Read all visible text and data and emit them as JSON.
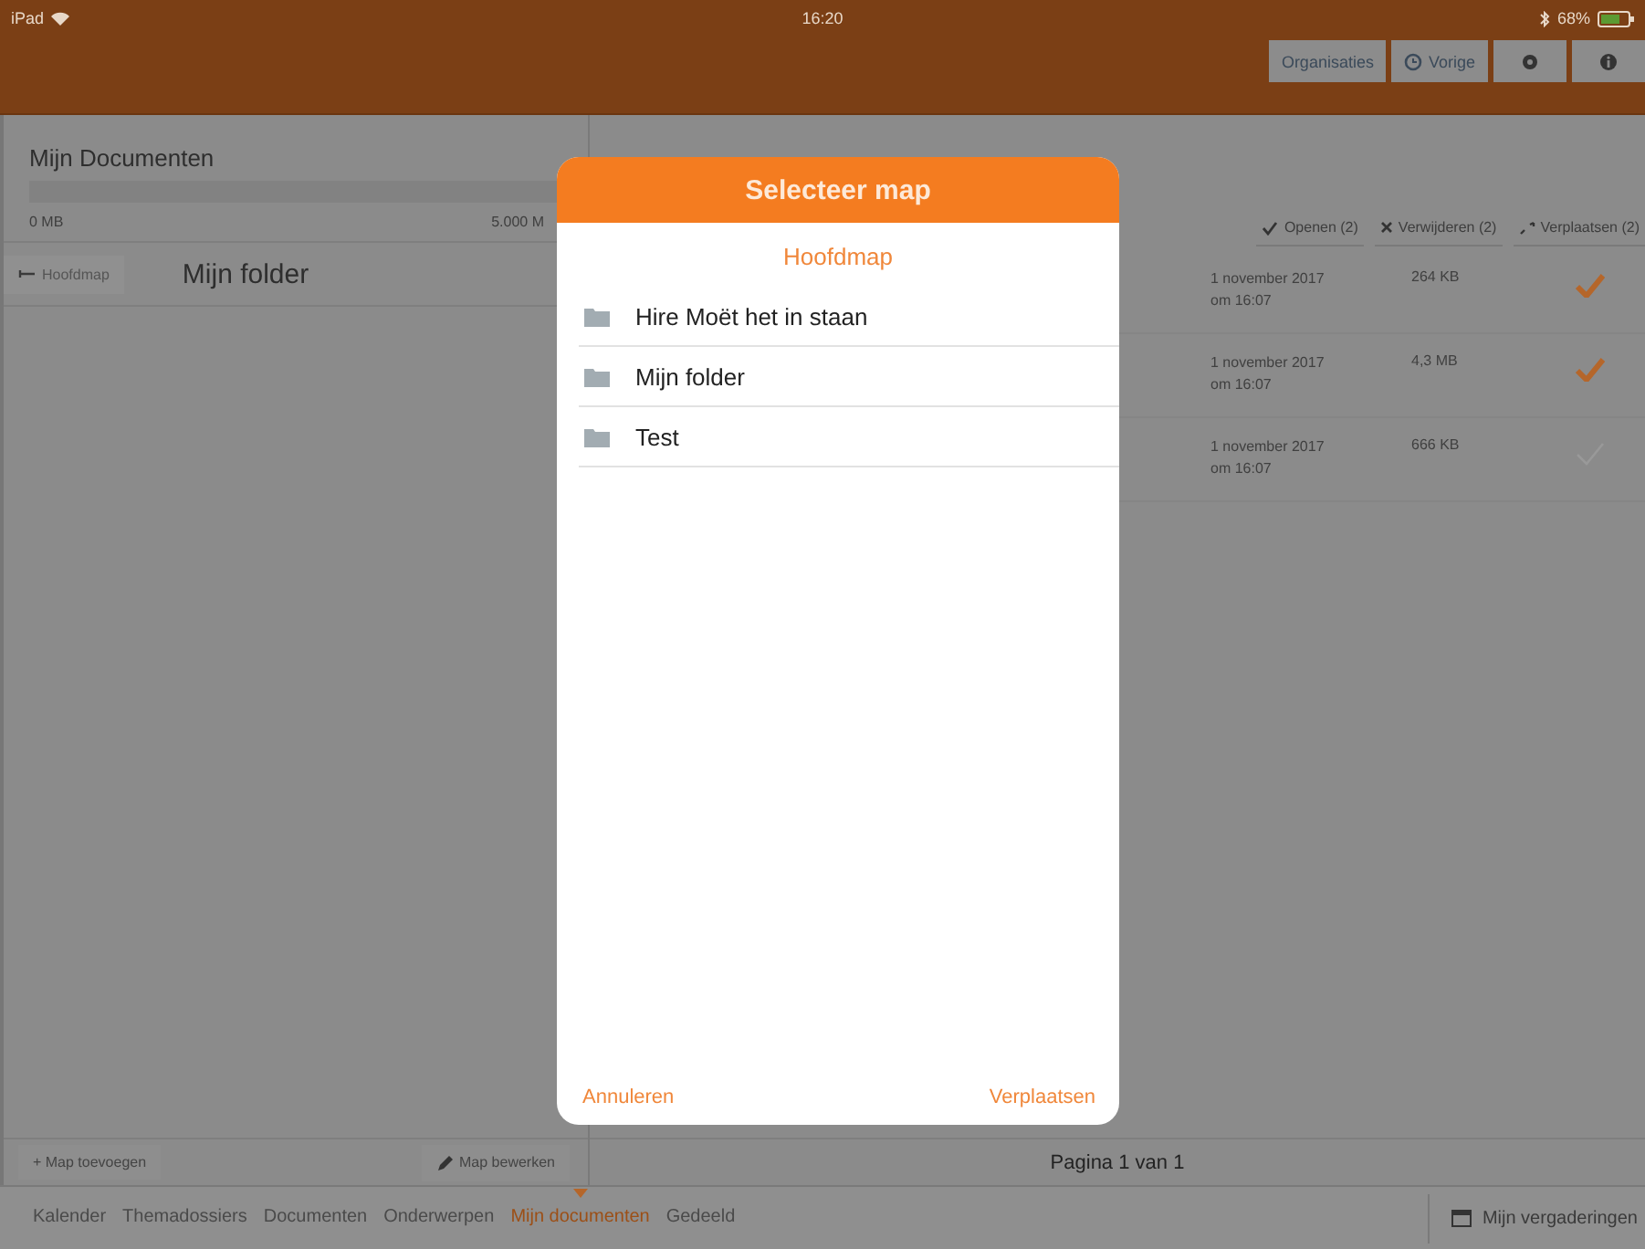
{
  "status_bar": {
    "device": "iPad",
    "time": "16:20",
    "battery": "68%"
  },
  "header": {
    "buttons": [
      {
        "label": "Organisaties",
        "kind": "text"
      },
      {
        "label": "Vorige",
        "kind": "back"
      },
      {
        "kind": "gear"
      },
      {
        "kind": "info"
      }
    ]
  },
  "sidebar": {
    "title": "Mijn Documenten",
    "storage": {
      "min": "0 MB",
      "max": "5.000 M"
    },
    "back_button": "Hoofdmap",
    "folder_title": "Mijn folder",
    "add_button": "Map toevoegen",
    "add_icon": "+",
    "edit_button": "Map bewerken"
  },
  "toolbar": [
    {
      "label": "Openen (2)",
      "kind": "check"
    },
    {
      "label": "Verwijderen (2)",
      "kind": "cross"
    },
    {
      "label": "Verplaatsen (2)",
      "kind": "move"
    }
  ],
  "files": [
    {
      "date": "1 november 2017",
      "time": "om 16:07",
      "size": "264 KB",
      "checked": true
    },
    {
      "date": "1 november 2017",
      "time": "om 16:07",
      "size": "4,3 MB",
      "checked": true
    },
    {
      "date": "1 november 2017",
      "time": "om 16:07",
      "size": "666 KB",
      "checked": false
    }
  ],
  "pagination": "Pagina 1 van 1",
  "tabs": [
    {
      "label": "Kalender",
      "selected": false
    },
    {
      "label": "Themadossiers",
      "selected": false
    },
    {
      "label": "Documenten",
      "selected": false
    },
    {
      "label": "Onderwerpen",
      "selected": false
    },
    {
      "label": "Mijn documenten",
      "selected": true
    },
    {
      "label": "Gedeeld",
      "selected": false
    }
  ],
  "meetings_button": "Mijn vergaderingen",
  "dialog": {
    "title": "Selecteer map",
    "subtitle": "Hoofdmap",
    "folders": [
      "Hire Moët het in staan",
      "Mijn folder",
      "Test"
    ],
    "cancel": "Annuleren",
    "confirm": "Verplaatsen"
  }
}
